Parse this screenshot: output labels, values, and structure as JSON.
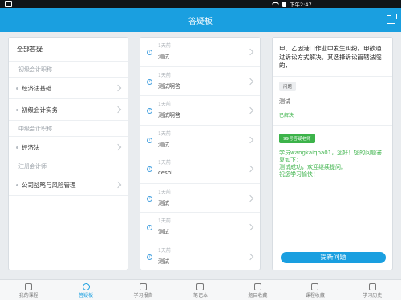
{
  "status": {
    "time": "下午2:47"
  },
  "header": {
    "title": "答疑板"
  },
  "categories": {
    "all_label": "全部答疑",
    "sections": [
      {
        "title": "初级会计职称",
        "items": [
          "经济法基础",
          "初级会计实务"
        ]
      },
      {
        "title": "中级会计职称",
        "items": [
          "经济法"
        ]
      },
      {
        "title": "注册会计师",
        "items": [
          "公司战略与风险管理"
        ]
      }
    ]
  },
  "questions": [
    {
      "time": "1天前",
      "text": "测试"
    },
    {
      "time": "1天前",
      "text": "测试啊答"
    },
    {
      "time": "1天前",
      "text": "测试啊答"
    },
    {
      "time": "1天前",
      "text": "测试"
    },
    {
      "time": "1天前",
      "text": "ceshi"
    },
    {
      "time": "1天前",
      "text": "测试"
    },
    {
      "time": "1天前",
      "text": "测试"
    },
    {
      "time": "1天前",
      "text": "测试"
    }
  ],
  "detail": {
    "question": "甲、乙因港口作业中发生纠纷，甲欲通过诉讼方式解决。其选择诉讼管辖法院的，",
    "ask_tag": "问题",
    "ask_text": "测试",
    "status": "已解决",
    "teacher_tag": "99号答疑老师",
    "answer": "学员wangkaiqpa01，您好！您的问题答复如下：\n测试成功，欢迎继续提问。\n祝您学习愉快！",
    "submit_label": "提新问题"
  },
  "tabs": [
    "我的课程",
    "答疑板",
    "学习报告",
    "笔记本",
    "题目收藏",
    "课程收藏",
    "学习历史"
  ]
}
